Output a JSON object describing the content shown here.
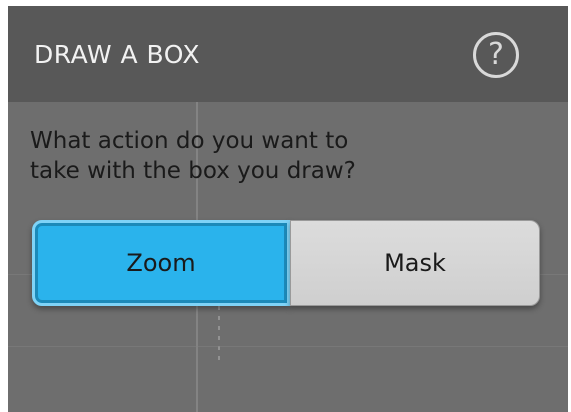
{
  "dialog": {
    "title": "DRAW A BOX",
    "help_glyph": "?",
    "question_line1": "What action do you want to",
    "question_line2": "take with the box you draw?",
    "options": [
      {
        "label": "Zoom",
        "selected": true
      },
      {
        "label": "Mask",
        "selected": false
      }
    ]
  },
  "colors": {
    "selected_option": "#2ab3ec",
    "header": "#585858",
    "body": "#6e6e6e"
  },
  "icons": [
    "help-icon"
  ]
}
